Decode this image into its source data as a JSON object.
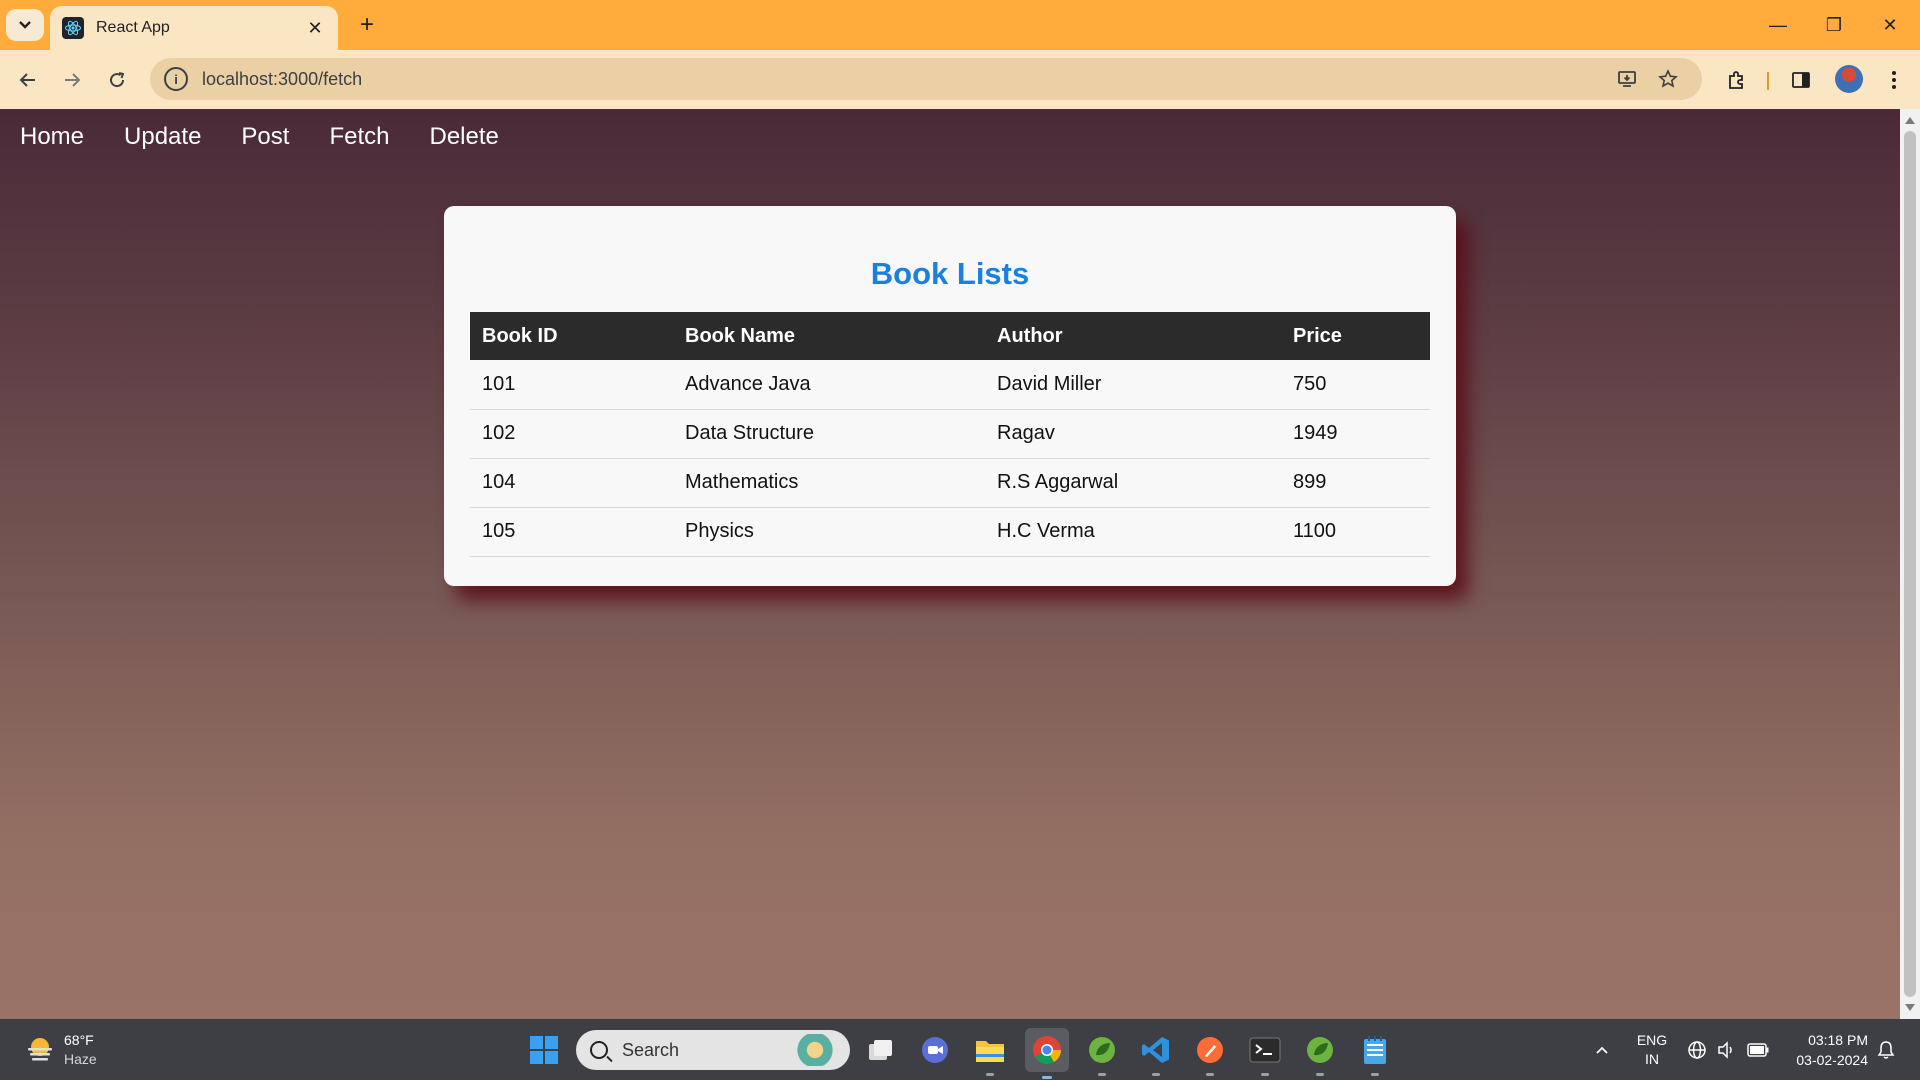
{
  "browser": {
    "tab_title": "React App",
    "url": "localhost:3000/fetch",
    "tab_close_glyph": "✕",
    "new_tab_glyph": "+",
    "window": {
      "minimize": "—",
      "maximize": "❐",
      "close": "✕"
    }
  },
  "app": {
    "nav": [
      {
        "label": "Home"
      },
      {
        "label": "Update"
      },
      {
        "label": "Post"
      },
      {
        "label": "Fetch"
      },
      {
        "label": "Delete"
      }
    ],
    "title": "Book Lists",
    "columns": [
      "Book ID",
      "Book Name",
      "Author",
      "Price"
    ],
    "rows": [
      {
        "id": "101",
        "name": "Advance Java",
        "author": "David Miller",
        "price": "750"
      },
      {
        "id": "102",
        "name": "Data Structure",
        "author": "Ragav",
        "price": "1949"
      },
      {
        "id": "104",
        "name": "Mathematics",
        "author": "R.S Aggarwal",
        "price": "899"
      },
      {
        "id": "105",
        "name": "Physics",
        "author": "H.C Verma",
        "price": "1100"
      }
    ],
    "colors": {
      "title": "#1a7fe0",
      "header_bg": "#2b2b2b",
      "card_bg": "#f8f8f8"
    }
  },
  "taskbar": {
    "weather": {
      "temp": "68°F",
      "desc": "Haze"
    },
    "search_label": "Search",
    "language": {
      "top": "ENG",
      "bottom": "IN"
    },
    "clock": {
      "time": "03:18 PM",
      "date": "03-02-2024"
    },
    "apps": [
      "start-menu",
      "search",
      "task-view",
      "teams-meet",
      "file-explorer",
      "chrome",
      "spring-tool",
      "vscode",
      "postman",
      "terminal",
      "spring-tool-2",
      "notepad"
    ]
  }
}
